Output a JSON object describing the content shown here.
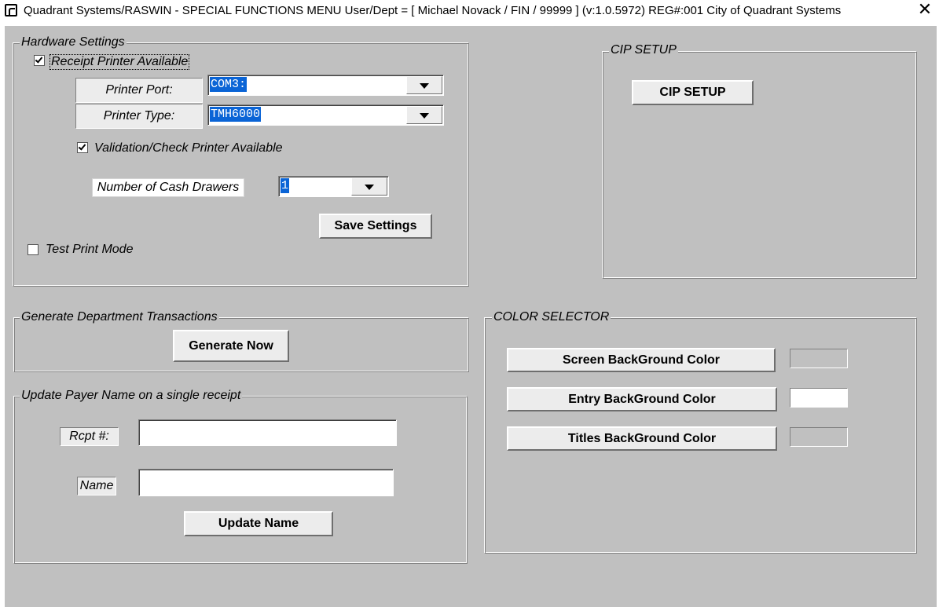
{
  "window": {
    "title": "Quadrant Systems/RASWIN - SPECIAL FUNCTIONS MENU User/Dept = [ Michael Novack / FIN / 99999 ] (v:1.0.5972) REG#:001 City of Quadrant Systems",
    "close_glyph": "✕",
    "app_icon": "raswin-app-icon",
    "close_icon": "close-icon"
  },
  "hardware": {
    "legend": "Hardware Settings",
    "receipt_printer_label": "Receipt Printer Available",
    "receipt_printer_checked": true,
    "printer_port_label": "Printer Port:",
    "printer_port_value": "COM3:",
    "printer_type_label": "Printer Type:",
    "printer_type_value": "TMH6000",
    "validation_printer_label": "Validation/Check Printer Available",
    "validation_printer_checked": true,
    "cash_drawers_label": "Number of Cash Drawers",
    "cash_drawers_value": "1",
    "save_button": "Save Settings",
    "test_print_label": "Test Print Mode",
    "test_print_checked": false
  },
  "cip": {
    "legend": "CIP SETUP",
    "button": "CIP SETUP"
  },
  "generate": {
    "legend": "Generate Department Transactions",
    "button": "Generate Now"
  },
  "update_payer": {
    "legend": "Update Payer Name on a single receipt",
    "rcpt_label": "Rcpt #:",
    "rcpt_value": "",
    "name_label": "Name",
    "name_value": "",
    "button": "Update Name"
  },
  "color_selector": {
    "legend": "COLOR SELECTOR",
    "screen_bg_button": "Screen BackGround Color",
    "screen_bg_color": "#c0c0c0",
    "entry_bg_button": "Entry BackGround Color",
    "entry_bg_color": "#ffffff",
    "titles_bg_button": "Titles BackGround Color",
    "titles_bg_color": "#c0c0c0"
  },
  "colors": {
    "client_background": "#c0c0c0",
    "selection_highlight": "#0a64d6",
    "button_face": "#ececec"
  }
}
